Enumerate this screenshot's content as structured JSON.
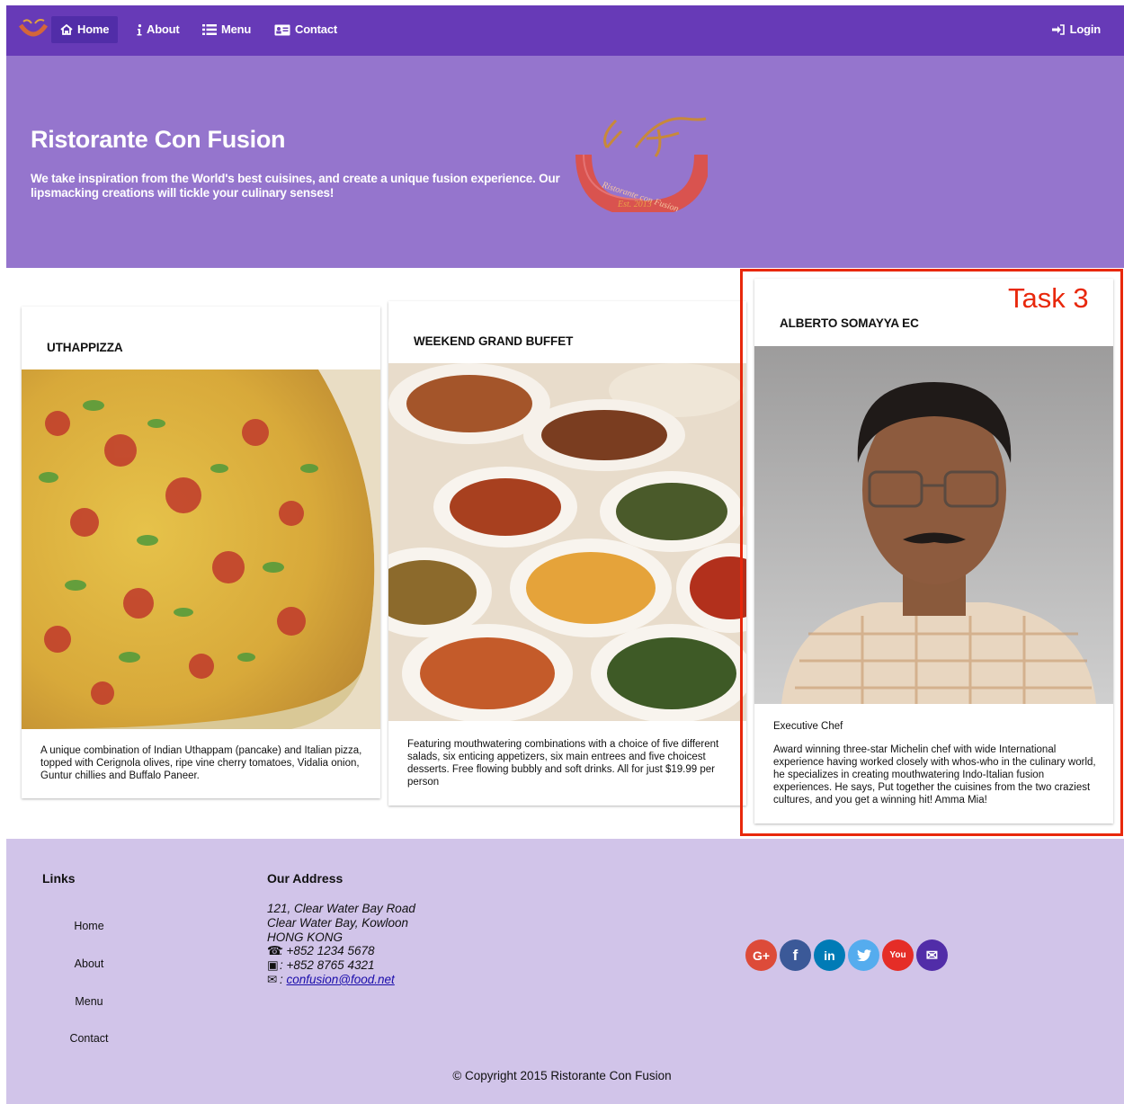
{
  "nav": {
    "items": [
      {
        "label": "Home",
        "icon": "home-icon",
        "active": true
      },
      {
        "label": "About",
        "icon": "info-icon",
        "active": false
      },
      {
        "label": "Menu",
        "icon": "list-icon",
        "active": false
      },
      {
        "label": "Contact",
        "icon": "address-card-icon",
        "active": false
      }
    ],
    "login_label": "Login"
  },
  "jumbotron": {
    "title": "Ristorante Con Fusion",
    "text": "We take inspiration from the World's best cuisines, and create a unique fusion experience. Our lipsmacking creations will tickle your culinary senses!",
    "logo_text": "Ristorante con Fusion",
    "logo_est": "Est. 2013"
  },
  "cards": [
    {
      "title": "UTHAPPIZZA",
      "description": "A unique combination of Indian Uthappam (pancake) and Italian pizza, topped with Cerignola olives, ripe vine cherry tomatoes, Vidalia onion, Guntur chillies and Buffalo Paneer."
    },
    {
      "title": "WEEKEND GRAND BUFFET",
      "description": "Featuring mouthwatering combinations with a choice of five different salads, six enticing appetizers, six main entrees and five choicest desserts. Free flowing bubbly and soft drinks. All for just $19.99 per person"
    },
    {
      "title": "ALBERTO SOMAYYA EC",
      "designation": "Executive Chef",
      "description": "Award winning three-star Michelin chef with wide International experience having worked closely with whos-who in the culinary world, he specializes in creating mouthwatering Indo-Italian fusion experiences. He says, Put together the cuisines from the two craziest cultures, and you get a winning hit! Amma Mia!"
    }
  ],
  "annotation": {
    "label": "Task 3",
    "color": "#e8280c"
  },
  "footer": {
    "links_title": "Links",
    "links": [
      "Home",
      "About",
      "Menu",
      "Contact"
    ],
    "address_title": "Our Address",
    "address_lines": [
      "121, Clear Water Bay Road",
      "Clear Water Bay, Kowloon",
      "HONG KONG"
    ],
    "phone": ": +852 1234 5678",
    "fax": ": +852 8765 4321",
    "email_prefix": ": ",
    "email": "confusion@food.net",
    "social": [
      {
        "name": "google-plus",
        "glyph": "G+",
        "color": "#dd4b39"
      },
      {
        "name": "facebook",
        "glyph": "f",
        "color": "#3b5998"
      },
      {
        "name": "linkedin",
        "glyph": "in",
        "color": "#007bb6"
      },
      {
        "name": "twitter",
        "glyph": "t",
        "color": "#55acee"
      },
      {
        "name": "youtube",
        "glyph": "You",
        "color": "#bb0000"
      },
      {
        "name": "mail",
        "glyph": "✉",
        "color": "#512da8"
      }
    ],
    "copyright": "© Copyright 2015 Ristorante Con Fusion"
  },
  "colors": {
    "primary": "#673ab7",
    "primary_dark": "#512da8",
    "primary_light": "#9575cd",
    "footer_bg": "#d1c4e9"
  }
}
